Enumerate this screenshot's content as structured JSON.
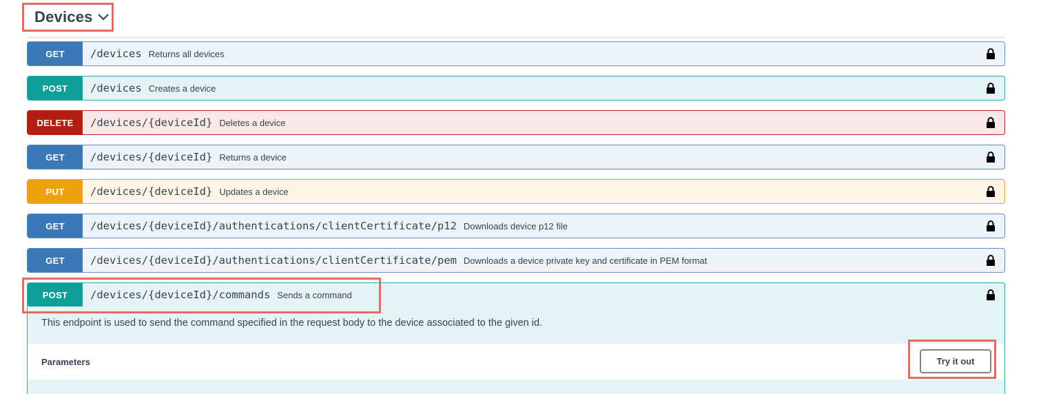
{
  "section": {
    "title": "Devices"
  },
  "operations": [
    {
      "method": "GET",
      "path": "/devices",
      "summary": "Returns all devices"
    },
    {
      "method": "POST",
      "path": "/devices",
      "summary": "Creates a device"
    },
    {
      "method": "DELETE",
      "path": "/devices/{deviceId}",
      "summary": "Deletes a device"
    },
    {
      "method": "GET",
      "path": "/devices/{deviceId}",
      "summary": "Returns a device"
    },
    {
      "method": "PUT",
      "path": "/devices/{deviceId}",
      "summary": "Updates a device"
    },
    {
      "method": "GET",
      "path": "/devices/{deviceId}/authentications/clientCertificate/p12",
      "summary": "Downloads device p12 file"
    },
    {
      "method": "GET",
      "path": "/devices/{deviceId}/authentications/clientCertificate/pem",
      "summary": "Downloads a device private key and certificate in PEM format"
    }
  ],
  "expanded": {
    "method": "POST",
    "path": "/devices/{deviceId}/commands",
    "summary": "Sends a command",
    "description": "This endpoint is used to send the command specified in the request body to the device associated to the given id.",
    "parameters_label": "Parameters",
    "try_label": "Try it out"
  },
  "colors": {
    "get": "#3c78b5",
    "post": "#0f9f9b",
    "delete": "#b41d12",
    "put": "#eda20c",
    "highlight": "#e46b5e"
  },
  "icons": {
    "lock": "lock-icon",
    "chevron": "chevron-down-icon"
  }
}
